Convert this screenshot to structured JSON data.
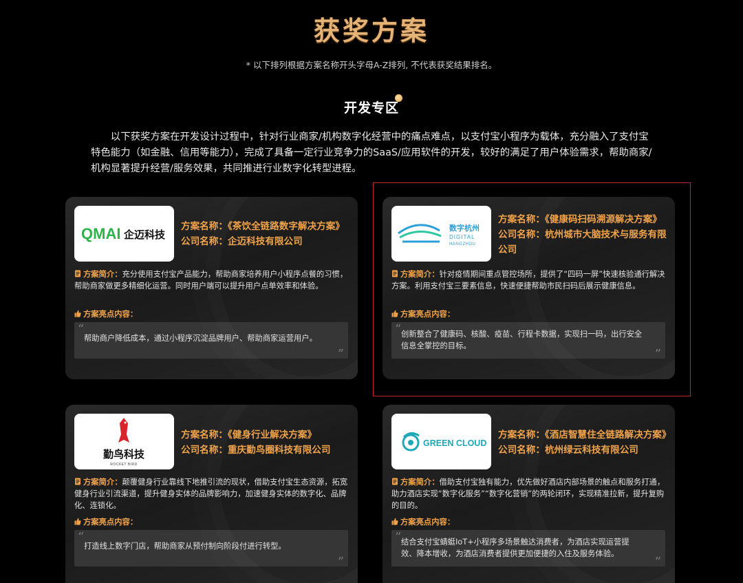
{
  "header": {
    "title": "获奖方案",
    "subtitle": "* 以下排列根据方案名称开头字母A-Z排列, 不代表获奖结果排名。"
  },
  "section": {
    "title": "开发专区",
    "intro": "以下获奖方案在开发设计过程中，针对行业商家/机构数字化经营中的痛点难点，以支付宝小程序为载体，充分融入了支付宝特色能力（如金融、信用等能力），完成了具备一定行业竞争力的SaaS/应用软件的开发，较好的满足了用户体验需求，帮助商家/机构显著提升经营/服务效果，共同推进行业数字化转型进程。"
  },
  "labels": {
    "plan_name": "方案名称：",
    "company_name": "公司名称：",
    "intro": "方案简介：",
    "highlights": "方案亮点内容："
  },
  "colors": {
    "accent": "#f0a34a",
    "title_gold": "#e6b377",
    "card_bg": "#222222",
    "quote_bg": "#363636",
    "selection_border": "#c0262e"
  },
  "cards": [
    {
      "logo": {
        "text_latin": "QMAI",
        "text_cn": "企迈科技",
        "color": "#2ab44a"
      },
      "plan": "《茶饮全链路数字解决方案》",
      "company": "企迈科技有限公司",
      "intro": "充分使用支付宝产品能力，帮助商家培养用户小程序点餐的习惯，帮助商家做更多精细化运营。同时用户端可以提升用户点单效率和体验。",
      "highlight": "帮助商户降低成本，通过小程序沉淀品牌用户、帮助商家运营用户。"
    },
    {
      "logo": {
        "text_cn": "数字杭州",
        "text_latin": "DIGITAL",
        "text_latin2": "HANGZHOU",
        "color": "#2a9fd8"
      },
      "plan": "《健康码扫码溯源解决方案》",
      "company": "杭州城市大脑技术与服务有限公司",
      "intro": "针对疫情期间重点管控场所，提供了“四码一屏”快速核验通行解决方案。利用支付宝三要素信息，快速便捷帮助市民扫码后展示健康信息。",
      "highlight": "创新整合了健康码、核酸、疫苗、行程卡数据，实现扫一码，出行安全信息全掌控的目标。"
    },
    {
      "logo": {
        "text_cn": "勤鸟科技",
        "text_latin": "ROCKET BIRD",
        "color": "#d8262c"
      },
      "plan": "《健身行业解决方案》",
      "company": "重庆勤鸟圈科技有限公司",
      "intro": "颠覆健身行业靠线下地推引流的现状，借助支付宝生态资源，拓宽健身行业引流渠道，提升健身实体的品牌影响力，加速健身实体的数字化、品牌化、连锁化。",
      "highlight": "打造线上数字门店，帮助商家从预付制向阶段付进行转型。"
    },
    {
      "logo": {
        "text_latin": "GREEN CLOUD",
        "color": "#1fa9b8"
      },
      "plan": "《酒店智慧住全链路解决方案》",
      "company": "杭州绿云科技有限公司",
      "intro": "借助支付宝独有能力，优先做好酒店内部场景的触点和服务打通，助力酒店实现“数字化服务”“数字化营销”的两轮闭环，实现精准拉新，提升复购的目的。",
      "highlight": "结合支付宝蜻蜓IoT+小程序多场景触达消费者，为酒店实现运营提效、降本增收，为酒店消费者提供更加便捷的入住及服务体验。"
    }
  ]
}
